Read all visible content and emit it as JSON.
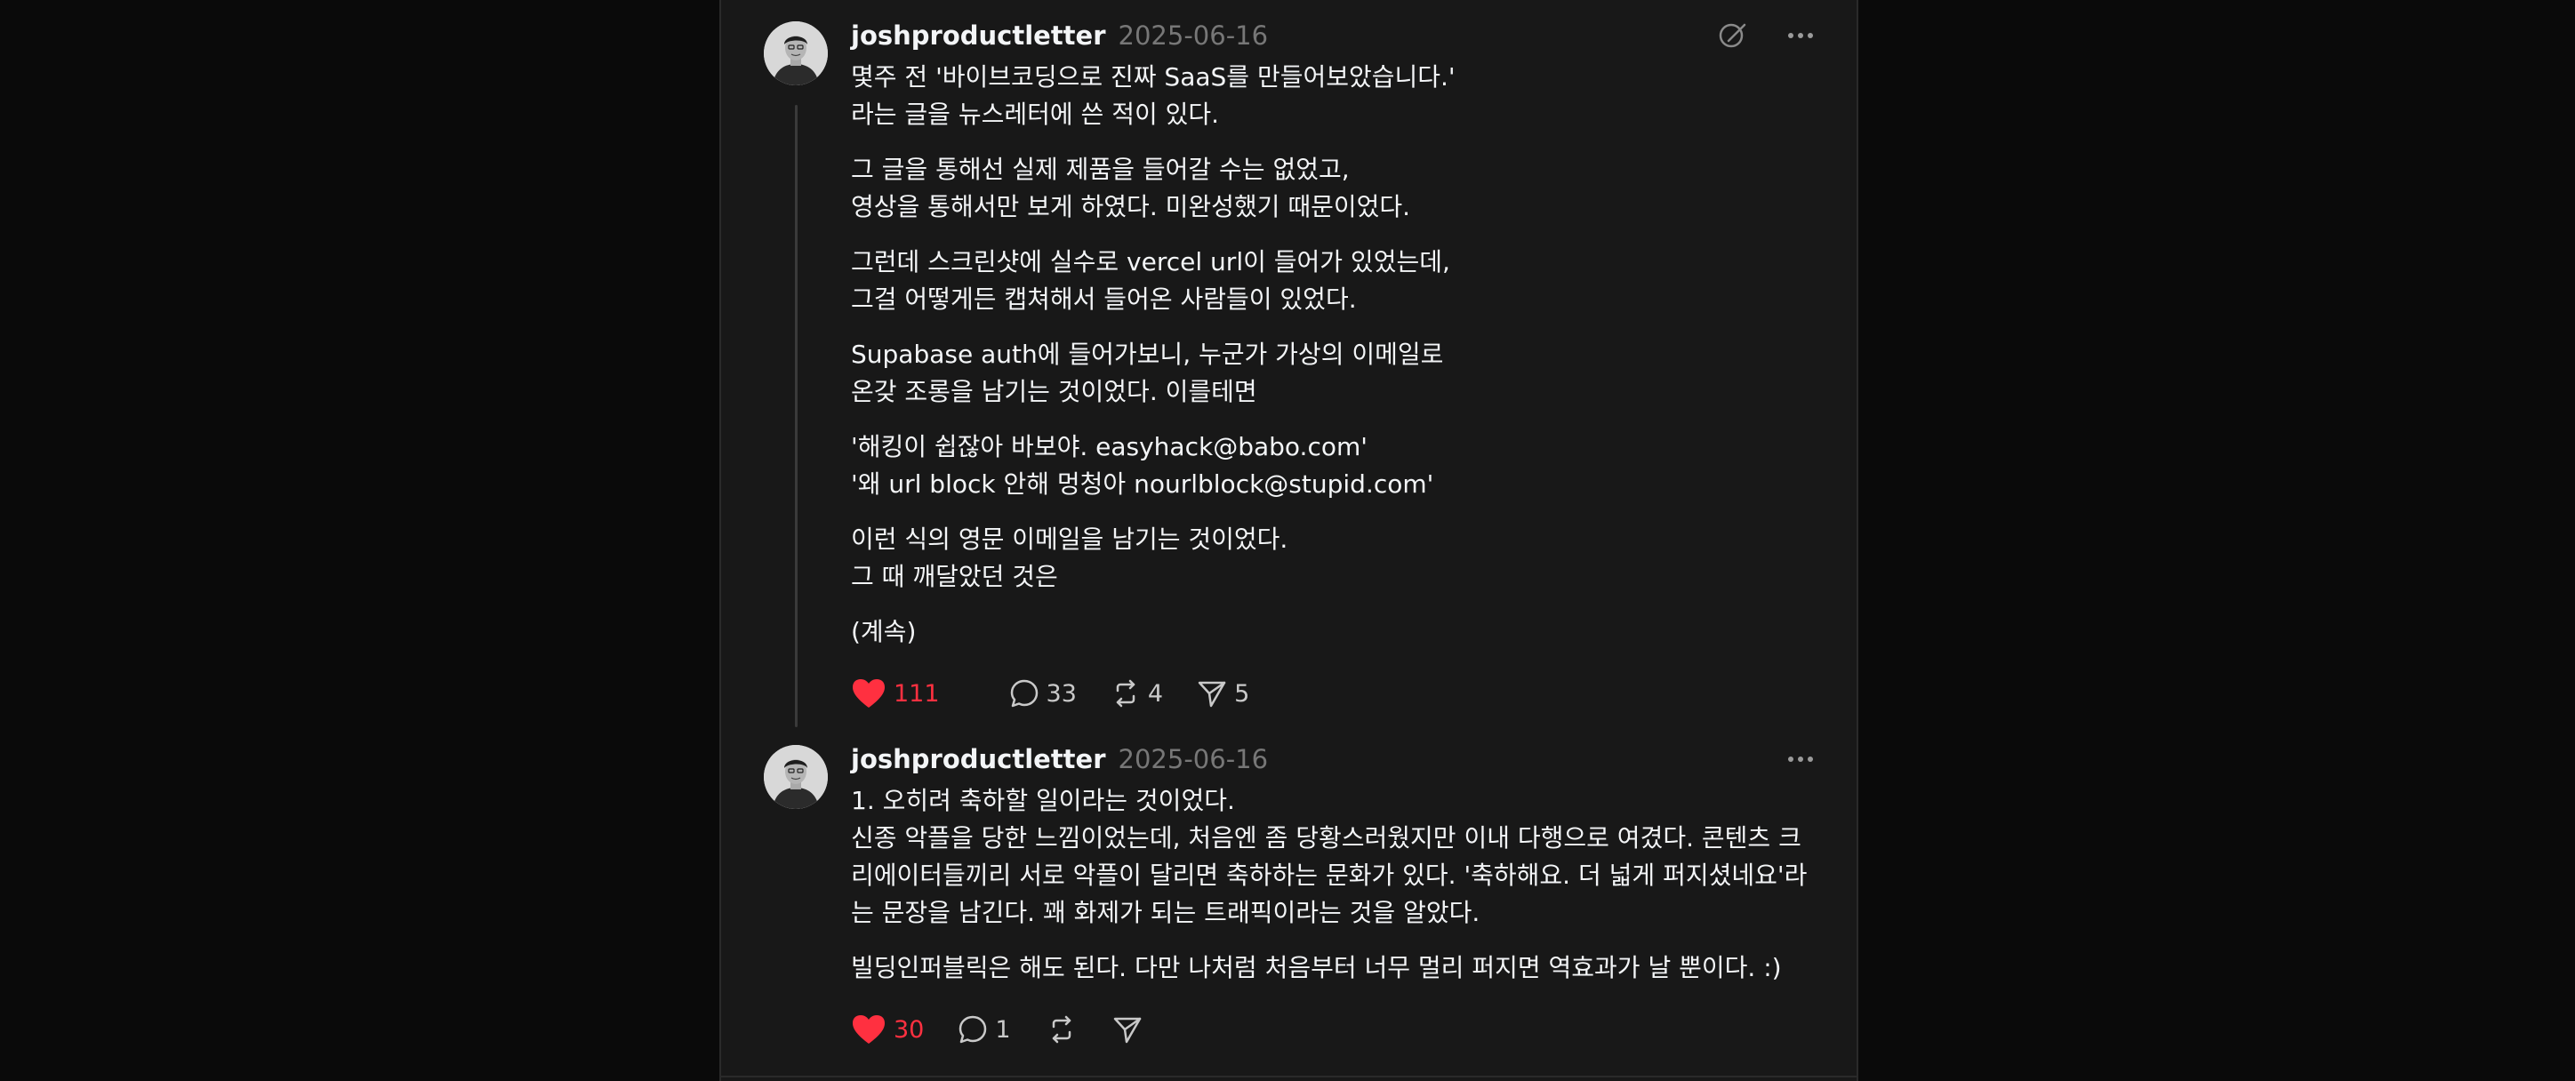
{
  "colors": {
    "background": "#0a0a0a",
    "panel": "#181818",
    "text": "#f3f5f7",
    "muted": "#777777",
    "like": "#ff3040"
  },
  "posts": [
    {
      "username": "joshproductletter",
      "date": "2025-06-16",
      "top_icons": [
        "edit-note-icon",
        "more-icon"
      ],
      "paragraphs": [
        [
          "몇주 전 '바이브코딩으로 진짜 SaaS를 만들어보았습니다.'",
          "라는 글을 뉴스레터에 쓴 적이 있다."
        ],
        [
          "그 글을 통해선 실제 제품을 들어갈 수는 없었고,",
          "영상을 통해서만 보게 하였다. 미완성했기 때문이었다."
        ],
        [
          "그런데 스크린샷에 실수로 vercel url이 들어가 있었는데,",
          "그걸 어떻게든 캡쳐해서 들어온 사람들이 있었다."
        ],
        [
          "Supabase auth에 들어가보니, 누군가 가상의 이메일로",
          "온갖 조롱을 남기는 것이었다. 이를테면"
        ],
        [
          "'해킹이 쉽잖아 바보야. easyhack@babo.com'",
          "'왜 url block 안해 멍청아 nourlblock@stupid.com'"
        ],
        [
          "이런 식의 영문 이메일을 남기는 것이었다.",
          "그 때 깨달았던 것은"
        ],
        [
          "(계속)"
        ]
      ],
      "likes": "111",
      "comments": "33",
      "reposts": "4",
      "shares": "5"
    },
    {
      "username": "joshproductletter",
      "date": "2025-06-16",
      "top_icons": [
        "more-icon"
      ],
      "paragraphs": [
        [
          "1. 오히려 축하할 일이라는 것이었다.",
          "신종 악플을 당한 느낌이었는데, 처음엔 좀 당황스러웠지만 이내 다행으로 여겼다. 콘텐츠 크리에이터들끼리 서로 악플이 달리면 축하하는 문화가 있다. '축하해요. 더 넓게 퍼지셨네요'라는 문장을 남긴다. 꽤 화제가 되는 트래픽이라는 것을 알았다."
        ],
        [
          "빌딩인퍼블릭은 해도 된다. 다만 나처럼 처음부터 너무 멀리 퍼지면 역효과가 날 뿐이다. :)"
        ]
      ],
      "likes": "30",
      "comments": "1",
      "reposts": "",
      "shares": ""
    }
  ]
}
